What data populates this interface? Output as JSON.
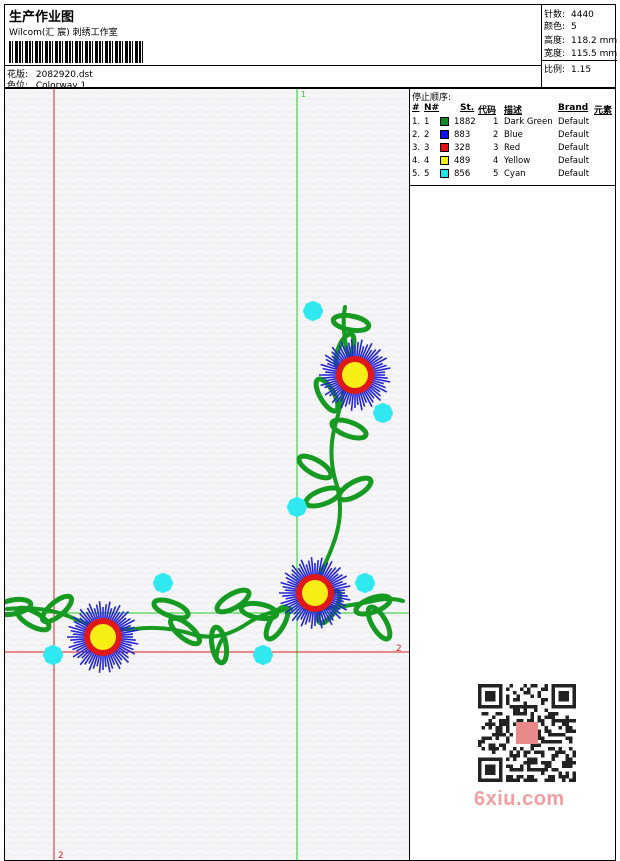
{
  "header": {
    "title": "生产作业图",
    "company": "Wilcom(汇 宸) 刺绣工作室",
    "design_label": "花版:",
    "design_value": "2082920.dst",
    "colorway_label": "色位:",
    "colorway_value": "Colorway 1"
  },
  "stats": [
    {
      "label": "针数:",
      "value": "4440"
    },
    {
      "label": "颜色:",
      "value": "5"
    },
    {
      "label": "高度:",
      "value": "118.2 mm"
    },
    {
      "label": "宽度:",
      "value": "115.5 mm"
    },
    {
      "label": "比例:",
      "value": "1.15"
    }
  ],
  "color_table": {
    "title": "停止顺序:",
    "headers": [
      "#",
      "N#",
      "St.",
      "代码",
      "描述",
      "Brand",
      "元素"
    ],
    "rows": [
      {
        "idx": "1.",
        "n": "1",
        "color": "#0f8a1c",
        "stitches": "1882",
        "code": "1",
        "desc": "Dark Green",
        "brand": "Default"
      },
      {
        "idx": "2.",
        "n": "2",
        "color": "#1010ee",
        "stitches": "883",
        "code": "2",
        "desc": "Blue",
        "brand": "Default"
      },
      {
        "idx": "3.",
        "n": "3",
        "color": "#e81010",
        "stitches": "328",
        "code": "3",
        "desc": "Red",
        "brand": "Default"
      },
      {
        "idx": "4.",
        "n": "4",
        "color": "#f4ee10",
        "stitches": "489",
        "code": "4",
        "desc": "Yellow",
        "brand": "Default"
      },
      {
        "idx": "5.",
        "n": "5",
        "color": "#22e6ee",
        "stitches": "856",
        "code": "5",
        "desc": "Cyan",
        "brand": "Default"
      }
    ]
  },
  "guides": {
    "green_label_top": "1",
    "red_label_right": "2",
    "red_label_bottom": "2"
  },
  "colors": {
    "guide_green": "#22cc22",
    "guide_red": "#dd2222",
    "stem": "#169a22",
    "petal": "#2424d6",
    "ring": "#e01818",
    "center": "#f6ee14",
    "bud": "#30e8f0"
  },
  "watermark": "6xiu.com"
}
